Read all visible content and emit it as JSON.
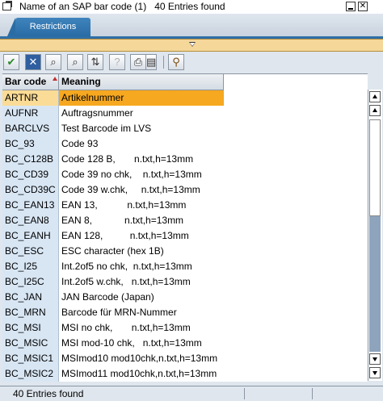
{
  "window": {
    "title": "Name of an SAP bar code (1)   40 Entries found",
    "minimize_icon": "minimize-icon",
    "close_icon": "close-icon"
  },
  "tabs": [
    {
      "label": "Restrictions"
    }
  ],
  "toolbar": {
    "buttons": [
      {
        "icon": "checkmark-icon"
      },
      {
        "icon": "cancel-icon"
      },
      {
        "icon": "find-icon"
      },
      {
        "icon": "find-next-icon"
      },
      {
        "icon": "sort-icon"
      },
      {
        "icon": "help-icon"
      },
      {
        "icon": "print-icon"
      },
      {
        "icon": "personal-list-icon"
      },
      {
        "icon": "pin-icon"
      }
    ]
  },
  "table": {
    "columns": [
      "Bar code",
      "Meaning"
    ],
    "rows": [
      {
        "code": "ARTNR",
        "meaning": "Artikelnummer"
      },
      {
        "code": "AUFNR",
        "meaning": "Auftragsnummer"
      },
      {
        "code": "BARCLVS",
        "meaning": "Test Barcode im LVS"
      },
      {
        "code": "BC_93",
        "meaning": "Code 93"
      },
      {
        "code": "BC_C128B",
        "meaning": "Code 128 B,       n.txt,h=13mm"
      },
      {
        "code": "BC_CD39",
        "meaning": "Code 39 no chk,    n.txt,h=13mm"
      },
      {
        "code": "BC_CD39C",
        "meaning": "Code 39 w.chk,     n.txt,h=13mm"
      },
      {
        "code": "BC_EAN13",
        "meaning": "EAN 13,           n.txt,h=13mm"
      },
      {
        "code": "BC_EAN8",
        "meaning": "EAN 8,            n.txt,h=13mm"
      },
      {
        "code": "BC_EANH",
        "meaning": "EAN 128,          n.txt,h=13mm"
      },
      {
        "code": "BC_ESC",
        "meaning": "ESC character (hex 1B)"
      },
      {
        "code": "BC_I25",
        "meaning": "Int.2of5 no chk,  n.txt,h=13mm"
      },
      {
        "code": "BC_I25C",
        "meaning": "Int.2of5 w.chk,   n.txt,h=13mm"
      },
      {
        "code": "BC_JAN",
        "meaning": "JAN Barcode (Japan)"
      },
      {
        "code": "BC_MRN",
        "meaning": "Barcode für MRN-Nummer"
      },
      {
        "code": "BC_MSI",
        "meaning": "MSI no chk,       n.txt,h=13mm"
      },
      {
        "code": "BC_MSIC",
        "meaning": "MSI mod-10 chk,   n.txt,h=13mm"
      },
      {
        "code": "BC_MSIC1",
        "meaning": "MSImod10 mod10chk,n.txt,h=13mm"
      },
      {
        "code": "BC_MSIC2",
        "meaning": "MSImod11 mod10chk,n.txt,h=13mm"
      }
    ],
    "selected_row": 0
  },
  "status": {
    "text": "40 Entries found"
  }
}
